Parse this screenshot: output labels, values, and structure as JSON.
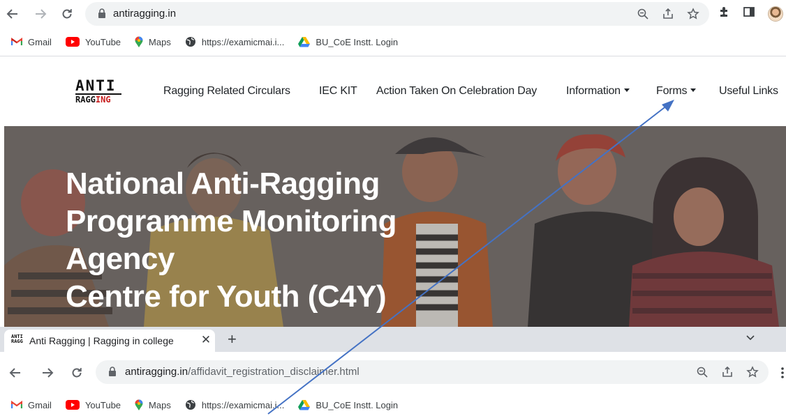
{
  "browser": {
    "url": "antiragging.in",
    "bookmarks": [
      {
        "label": "Gmail",
        "icon": "gmail-icon"
      },
      {
        "label": "YouTube",
        "icon": "youtube-icon"
      },
      {
        "label": "Maps",
        "icon": "maps-icon"
      },
      {
        "label": "https://examicmai.i...",
        "icon": "globe-icon"
      },
      {
        "label": "BU_CoE Instt. Login",
        "icon": "drive-icon"
      }
    ]
  },
  "site": {
    "logo": {
      "top": "ANTI",
      "bottom_prefix": "RAGG",
      "bottom_suffix": "ING"
    },
    "nav": {
      "circulars": "Ragging Related Circulars",
      "iec_kit": "IEC KIT",
      "action_taken": "Action Taken On Celebration Day",
      "information": "Information",
      "forms": "Forms",
      "useful_links": "Useful Links"
    },
    "hero": {
      "line1": "National Anti-Ragging",
      "line2": "Programme Monitoring",
      "line3": "Agency",
      "line4": "Centre for Youth (C4Y)"
    }
  },
  "second_window": {
    "tab_title": "Anti Ragging | Ragging in college",
    "url_host": "antiragging.in",
    "url_path": "/affidavit_registration_disclaimer.html",
    "bookmarks": [
      {
        "label": "Gmail",
        "icon": "gmail-icon"
      },
      {
        "label": "YouTube",
        "icon": "youtube-icon"
      },
      {
        "label": "Maps",
        "icon": "maps-icon"
      },
      {
        "label": "https://examicmai.i...",
        "icon": "globe-icon"
      },
      {
        "label": "BU_CoE Instt. Login",
        "icon": "drive-icon"
      }
    ]
  },
  "colors": {
    "hero_bg": "#6d6765",
    "arrow": "#4472c4",
    "omnibox": "#f1f3f4",
    "tabstrip": "#dee1e6"
  }
}
